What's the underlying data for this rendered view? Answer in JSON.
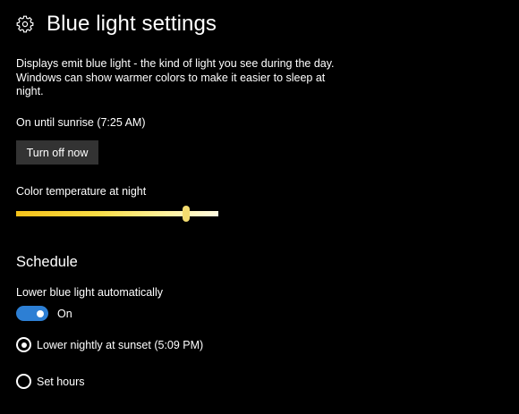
{
  "header": {
    "icon": "gear-icon",
    "title": "Blue light settings"
  },
  "description": "Displays emit blue light - the kind of light you see during the day. Windows can show warmer colors to make it easier to sleep at night.",
  "status": "On until sunrise (7:25 AM)",
  "turn_off_button": "Turn off now",
  "color_temperature": {
    "label": "Color temperature at night",
    "value_fraction": 0.84
  },
  "schedule": {
    "title": "Schedule",
    "auto_label": "Lower blue light automatically",
    "toggle": {
      "state_label": "On",
      "on": true,
      "color": "#2d7fd4"
    },
    "options": [
      {
        "label": "Lower nightly at sunset (5:09 PM)",
        "selected": true
      },
      {
        "label": "Set hours",
        "selected": false
      }
    ]
  }
}
